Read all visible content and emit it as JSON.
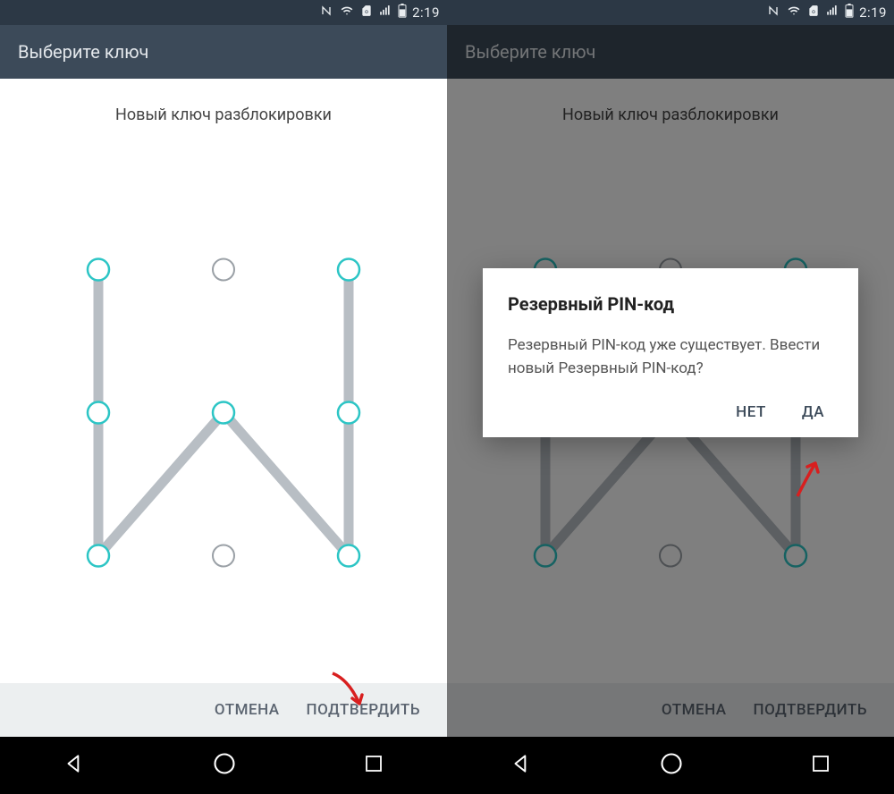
{
  "status": {
    "time": "2:19"
  },
  "left": {
    "title": "Выберите ключ",
    "instruction": "Новый ключ разблокировки",
    "cancel": "ОТМЕНА",
    "confirm": "ПОДТВЕРДИТЬ"
  },
  "right": {
    "title": "Выберите ключ",
    "instruction": "Новый ключ разблокировки",
    "cancel": "ОТМЕНА",
    "confirm": "ПОДТВЕРДИТЬ",
    "dialog": {
      "title": "Резервный PIN-код",
      "body": "Резервный PIN-код уже существует. Ввести новый Резервный PIN-код?",
      "no": "НЕТ",
      "yes": "ДА"
    }
  },
  "pattern": {
    "active_nodes": [
      0,
      2,
      3,
      4,
      5,
      6,
      8
    ],
    "path": [
      [
        0,
        3
      ],
      [
        3,
        6
      ],
      [
        6,
        4
      ],
      [
        4,
        8
      ],
      [
        8,
        5
      ],
      [
        5,
        2
      ]
    ]
  }
}
